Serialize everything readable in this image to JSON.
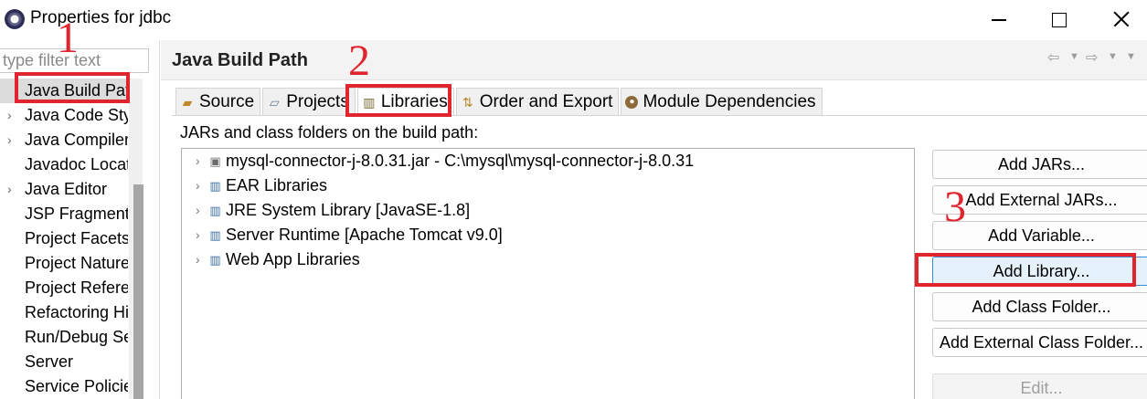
{
  "window": {
    "title": "Properties for jdbc",
    "controls": {
      "minimize": "minimize-icon",
      "maximize": "maximize-icon",
      "close": "close-icon"
    }
  },
  "sidebar": {
    "filter_placeholder": "type filter text",
    "items": [
      {
        "label": "Java Build Path",
        "expandable": false,
        "selected": true
      },
      {
        "label": "Java Code Style",
        "expandable": true
      },
      {
        "label": "Java Compiler",
        "expandable": true
      },
      {
        "label": "Javadoc Location",
        "expandable": false
      },
      {
        "label": "Java Editor",
        "expandable": true
      },
      {
        "label": "JSP Fragment",
        "expandable": false
      },
      {
        "label": "Project Facets",
        "expandable": false
      },
      {
        "label": "Project Natures",
        "expandable": false
      },
      {
        "label": "Project References",
        "expandable": false
      },
      {
        "label": "Refactoring History",
        "expandable": false
      },
      {
        "label": "Run/Debug Settings",
        "expandable": false
      },
      {
        "label": "Server",
        "expandable": false
      },
      {
        "label": "Service Policies",
        "expandable": false
      }
    ]
  },
  "main": {
    "title": "Java Build Path",
    "tabs": [
      {
        "label": "Source",
        "icon": "source-folder-icon"
      },
      {
        "label": "Projects",
        "icon": "projects-icon"
      },
      {
        "label": "Libraries",
        "icon": "libraries-icon",
        "active": true
      },
      {
        "label": "Order and Export",
        "icon": "order-export-icon"
      },
      {
        "label": "Module Dependencies",
        "icon": "module-icon"
      }
    ],
    "list_label": "JARs and class folders on the build path:",
    "libraries": [
      {
        "label": "mysql-connector-j-8.0.31.jar - C:\\mysql\\mysql-connector-j-8.0.31",
        "icon": "jar-icon"
      },
      {
        "label": "EAR Libraries",
        "icon": "library-icon"
      },
      {
        "label": "JRE System Library [JavaSE-1.8]",
        "icon": "library-icon"
      },
      {
        "label": "Server Runtime [Apache Tomcat v9.0]",
        "icon": "library-icon"
      },
      {
        "label": "Web App Libraries",
        "icon": "library-icon"
      }
    ],
    "buttons": {
      "add_jars": "Add JARs...",
      "add_external_jars": "Add External JARs...",
      "add_variable": "Add Variable...",
      "add_library": "Add Library...",
      "add_class_folder": "Add Class Folder...",
      "add_external_class_folder": "Add External Class Folder...",
      "edit": "Edit..."
    }
  },
  "annotations": {
    "step1": "1",
    "step2": "2",
    "step3": "3",
    "color": "#e0252f"
  }
}
